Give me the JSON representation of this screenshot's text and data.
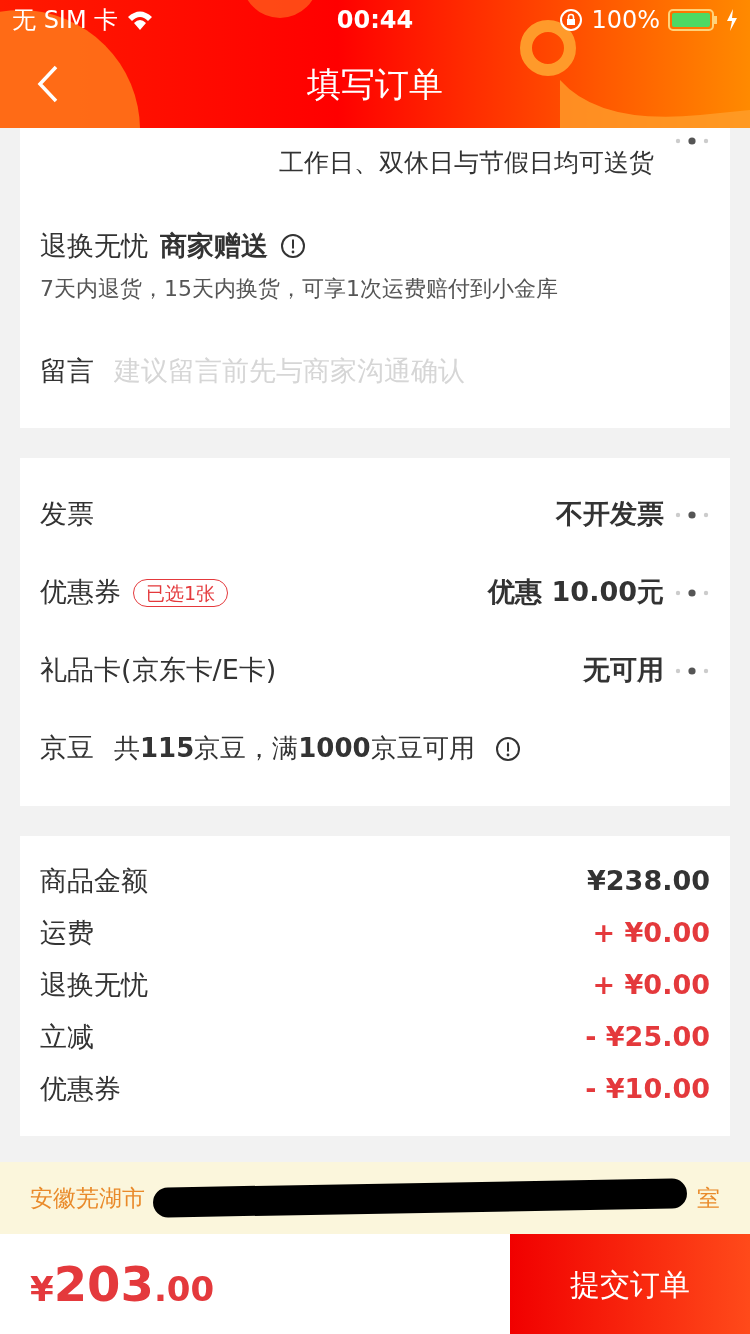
{
  "status_bar": {
    "carrier": "无 SIM 卡",
    "time": "00:44",
    "battery": "100%"
  },
  "header": {
    "title": "填写订单"
  },
  "delivery": {
    "note": "工作日、双休日与节假日均可送货"
  },
  "return_service": {
    "title": "退换无忧",
    "tag": "商家赠送",
    "description": "7天内退货，15天内换货，可享1次运费赔付到小金库"
  },
  "message": {
    "label": "留言",
    "placeholder": "建议留言前先与商家沟通确认"
  },
  "options": [
    {
      "kind": "link",
      "label": "发票",
      "value": "不开发票"
    },
    {
      "kind": "link",
      "label": "优惠券",
      "badge": "已选1张",
      "value": "优惠 10.00元"
    },
    {
      "kind": "link",
      "label": "礼品卡(京东卡/E卡)",
      "value": "无可用"
    },
    {
      "kind": "info",
      "label": "京豆",
      "value": "共**115**京豆，满**1000**京豆可用"
    }
  ],
  "summary": [
    {
      "label": "商品金额",
      "value": "¥238.00",
      "color": "#333333"
    },
    {
      "label": "运费",
      "value": "+ ¥0.00",
      "color": "#e4393c"
    },
    {
      "label": "退换无忧",
      "value": "+ ¥0.00",
      "color": "#e4393c"
    },
    {
      "label": "立减",
      "value": "- ¥25.00",
      "color": "#e4393c"
    },
    {
      "label": "优惠券",
      "value": "- ¥10.00",
      "color": "#e4393c"
    }
  ],
  "address_bar": {
    "start": "安徽芜湖市",
    "end": "室"
  },
  "footer": {
    "total": {
      "symbol": "¥",
      "integer": "203",
      "decimal": ".00"
    },
    "submit": "提交订单"
  }
}
